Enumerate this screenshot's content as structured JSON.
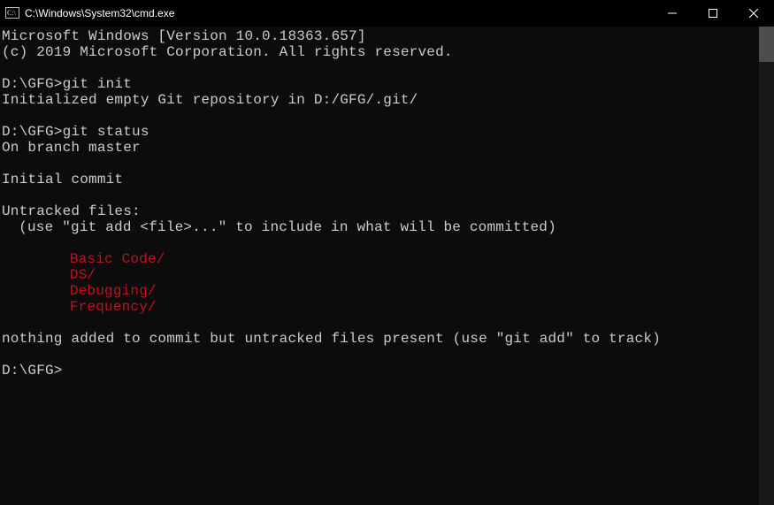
{
  "titlebar": {
    "path": "C:\\Windows\\System32\\cmd.exe"
  },
  "terminal": {
    "header1": "Microsoft Windows [Version 10.0.18363.657]",
    "header2": "(c) 2019 Microsoft Corporation. All rights reserved.",
    "prompt1": "D:\\GFG>",
    "cmd1": "git init",
    "out1": "Initialized empty Git repository in D:/GFG/.git/",
    "prompt2": "D:\\GFG>",
    "cmd2": "git status",
    "statusBranch": "On branch master",
    "statusInitial": "Initial commit",
    "untrackedHeader": "Untracked files:",
    "untrackedHint": "(use \"git add <file>...\" to include in what will be committed)",
    "untracked": {
      "f1": "Basic Code/",
      "f2": "DS/",
      "f3": "Debugging/",
      "f4": "Frequency/"
    },
    "nothingAdded": "nothing added to commit but untracked files present (use \"git add\" to track)",
    "prompt3": "D:\\GFG>"
  }
}
